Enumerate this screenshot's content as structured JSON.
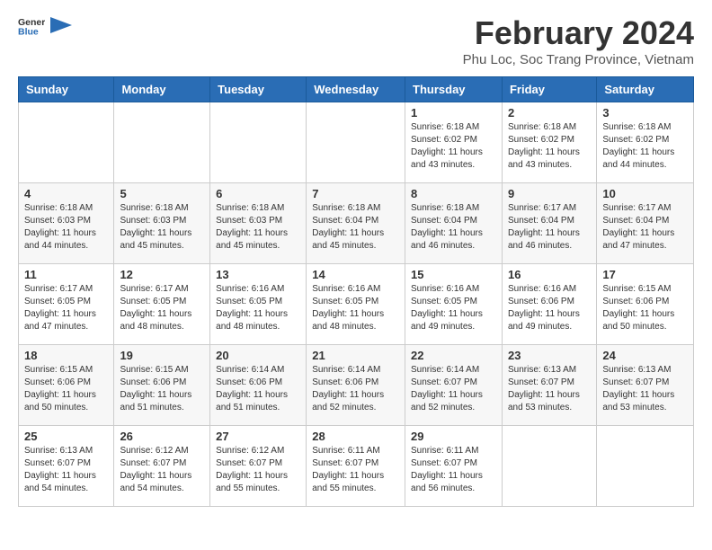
{
  "app": {
    "name_general": "General",
    "name_blue": "Blue"
  },
  "header": {
    "month_year": "February 2024",
    "location": "Phu Loc, Soc Trang Province, Vietnam"
  },
  "columns": [
    "Sunday",
    "Monday",
    "Tuesday",
    "Wednesday",
    "Thursday",
    "Friday",
    "Saturday"
  ],
  "weeks": [
    [
      {
        "day": "",
        "info": ""
      },
      {
        "day": "",
        "info": ""
      },
      {
        "day": "",
        "info": ""
      },
      {
        "day": "",
        "info": ""
      },
      {
        "day": "1",
        "info": "Sunrise: 6:18 AM\nSunset: 6:02 PM\nDaylight: 11 hours\nand 43 minutes."
      },
      {
        "day": "2",
        "info": "Sunrise: 6:18 AM\nSunset: 6:02 PM\nDaylight: 11 hours\nand 43 minutes."
      },
      {
        "day": "3",
        "info": "Sunrise: 6:18 AM\nSunset: 6:02 PM\nDaylight: 11 hours\nand 44 minutes."
      }
    ],
    [
      {
        "day": "4",
        "info": "Sunrise: 6:18 AM\nSunset: 6:03 PM\nDaylight: 11 hours\nand 44 minutes."
      },
      {
        "day": "5",
        "info": "Sunrise: 6:18 AM\nSunset: 6:03 PM\nDaylight: 11 hours\nand 45 minutes."
      },
      {
        "day": "6",
        "info": "Sunrise: 6:18 AM\nSunset: 6:03 PM\nDaylight: 11 hours\nand 45 minutes."
      },
      {
        "day": "7",
        "info": "Sunrise: 6:18 AM\nSunset: 6:04 PM\nDaylight: 11 hours\nand 45 minutes."
      },
      {
        "day": "8",
        "info": "Sunrise: 6:18 AM\nSunset: 6:04 PM\nDaylight: 11 hours\nand 46 minutes."
      },
      {
        "day": "9",
        "info": "Sunrise: 6:17 AM\nSunset: 6:04 PM\nDaylight: 11 hours\nand 46 minutes."
      },
      {
        "day": "10",
        "info": "Sunrise: 6:17 AM\nSunset: 6:04 PM\nDaylight: 11 hours\nand 47 minutes."
      }
    ],
    [
      {
        "day": "11",
        "info": "Sunrise: 6:17 AM\nSunset: 6:05 PM\nDaylight: 11 hours\nand 47 minutes."
      },
      {
        "day": "12",
        "info": "Sunrise: 6:17 AM\nSunset: 6:05 PM\nDaylight: 11 hours\nand 48 minutes."
      },
      {
        "day": "13",
        "info": "Sunrise: 6:16 AM\nSunset: 6:05 PM\nDaylight: 11 hours\nand 48 minutes."
      },
      {
        "day": "14",
        "info": "Sunrise: 6:16 AM\nSunset: 6:05 PM\nDaylight: 11 hours\nand 48 minutes."
      },
      {
        "day": "15",
        "info": "Sunrise: 6:16 AM\nSunset: 6:05 PM\nDaylight: 11 hours\nand 49 minutes."
      },
      {
        "day": "16",
        "info": "Sunrise: 6:16 AM\nSunset: 6:06 PM\nDaylight: 11 hours\nand 49 minutes."
      },
      {
        "day": "17",
        "info": "Sunrise: 6:15 AM\nSunset: 6:06 PM\nDaylight: 11 hours\nand 50 minutes."
      }
    ],
    [
      {
        "day": "18",
        "info": "Sunrise: 6:15 AM\nSunset: 6:06 PM\nDaylight: 11 hours\nand 50 minutes."
      },
      {
        "day": "19",
        "info": "Sunrise: 6:15 AM\nSunset: 6:06 PM\nDaylight: 11 hours\nand 51 minutes."
      },
      {
        "day": "20",
        "info": "Sunrise: 6:14 AM\nSunset: 6:06 PM\nDaylight: 11 hours\nand 51 minutes."
      },
      {
        "day": "21",
        "info": "Sunrise: 6:14 AM\nSunset: 6:06 PM\nDaylight: 11 hours\nand 52 minutes."
      },
      {
        "day": "22",
        "info": "Sunrise: 6:14 AM\nSunset: 6:07 PM\nDaylight: 11 hours\nand 52 minutes."
      },
      {
        "day": "23",
        "info": "Sunrise: 6:13 AM\nSunset: 6:07 PM\nDaylight: 11 hours\nand 53 minutes."
      },
      {
        "day": "24",
        "info": "Sunrise: 6:13 AM\nSunset: 6:07 PM\nDaylight: 11 hours\nand 53 minutes."
      }
    ],
    [
      {
        "day": "25",
        "info": "Sunrise: 6:13 AM\nSunset: 6:07 PM\nDaylight: 11 hours\nand 54 minutes."
      },
      {
        "day": "26",
        "info": "Sunrise: 6:12 AM\nSunset: 6:07 PM\nDaylight: 11 hours\nand 54 minutes."
      },
      {
        "day": "27",
        "info": "Sunrise: 6:12 AM\nSunset: 6:07 PM\nDaylight: 11 hours\nand 55 minutes."
      },
      {
        "day": "28",
        "info": "Sunrise: 6:11 AM\nSunset: 6:07 PM\nDaylight: 11 hours\nand 55 minutes."
      },
      {
        "day": "29",
        "info": "Sunrise: 6:11 AM\nSunset: 6:07 PM\nDaylight: 11 hours\nand 56 minutes."
      },
      {
        "day": "",
        "info": ""
      },
      {
        "day": "",
        "info": ""
      }
    ]
  ]
}
